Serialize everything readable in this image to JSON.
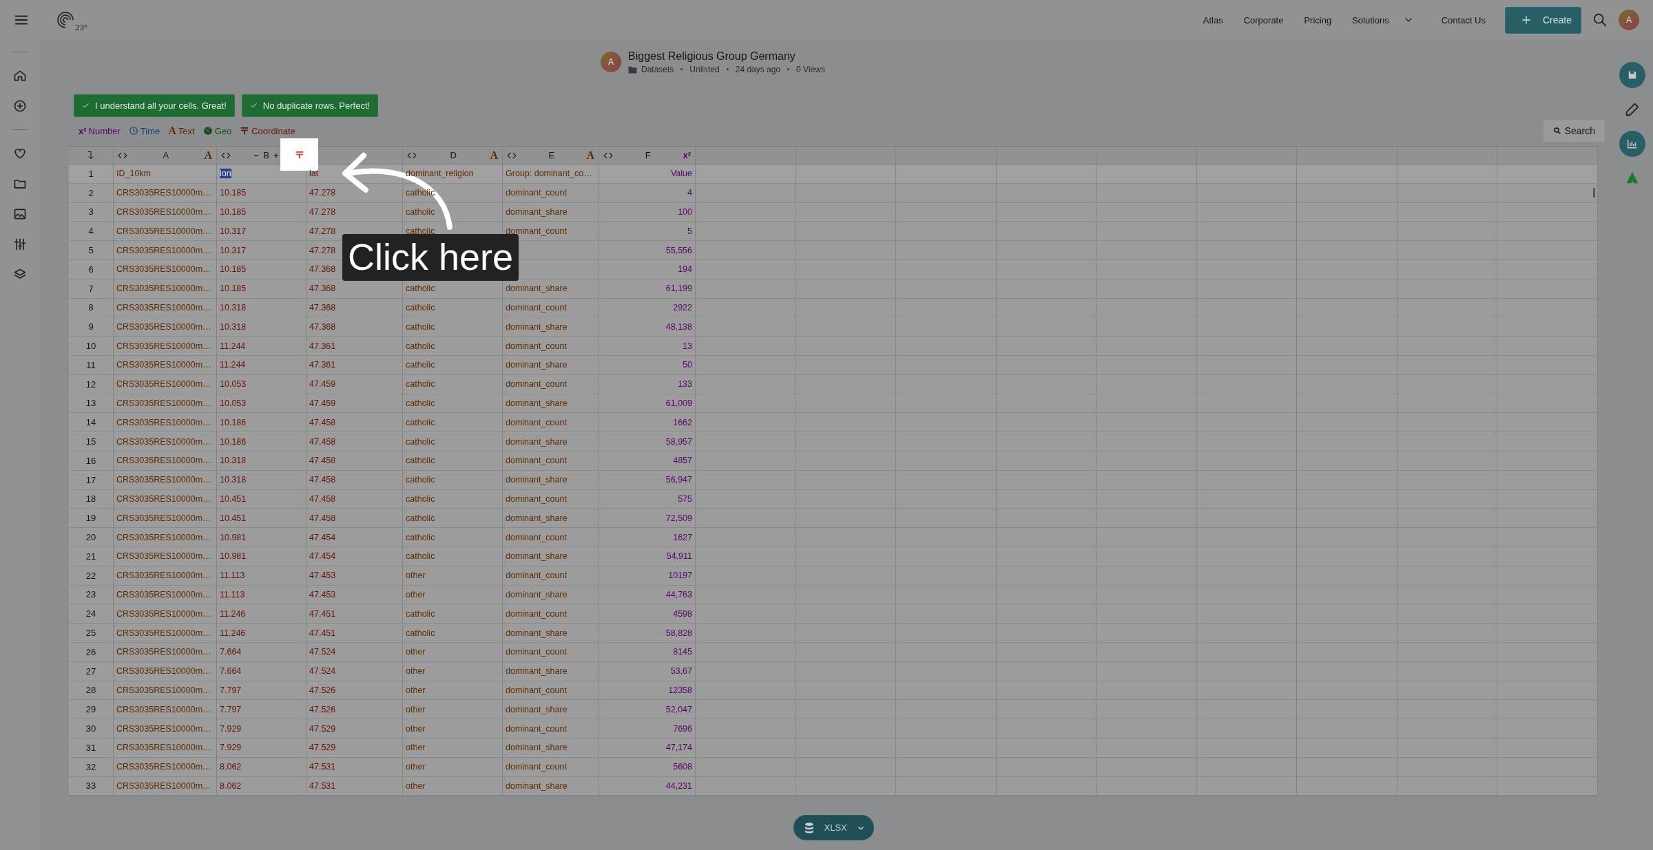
{
  "nav": {
    "logo_text": "23°",
    "links": [
      {
        "label": "Atlas",
        "dropdown": false
      },
      {
        "label": "Corporate",
        "dropdown": false
      },
      {
        "label": "Pricing",
        "dropdown": false
      },
      {
        "label": "Solutions",
        "dropdown": true
      },
      {
        "label": "Contact Us",
        "dropdown": false
      }
    ],
    "create": "Create",
    "avatar": "A"
  },
  "dataset": {
    "avatar": "A",
    "title": "Biggest Religious Group Germany",
    "meta": [
      "Datasets",
      "Unlisted",
      "24 days ago",
      "0 Views"
    ]
  },
  "checks": [
    "I understand all your cells. Great!",
    "No duplicate rows. Perfect!"
  ],
  "legend": [
    {
      "kind": "number",
      "symbol": "x²",
      "label": "Number"
    },
    {
      "kind": "time",
      "label": "Time"
    },
    {
      "kind": "text",
      "symbol": "A",
      "label": "Text"
    },
    {
      "kind": "geo",
      "label": "Geo"
    },
    {
      "kind": "coordinate",
      "label": "Coordinate"
    }
  ],
  "search": "Search",
  "table": {
    "columns": [
      {
        "letter": "A",
        "kind": "text",
        "symbol": "A",
        "stepper": false,
        "spotlight": false
      },
      {
        "letter": "B",
        "kind": "coordinate",
        "stepper": true,
        "spotlight": true
      },
      {
        "kind": "coordinate"
      },
      {
        "letter": "D",
        "kind": "text",
        "symbol": "A",
        "stepper": false,
        "spotlight": false
      },
      {
        "letter": "E",
        "kind": "text",
        "symbol": "A",
        "stepper": false,
        "spotlight": false
      },
      {
        "letter": "F",
        "kind": "number",
        "symbol": "x²",
        "stepper": false,
        "spotlight": false
      }
    ],
    "header_row": {
      "number": "1",
      "cells": [
        {
          "text": "ID_10km",
          "selected": false
        },
        {
          "text": "lon",
          "selected": true
        },
        {
          "text": "lat",
          "selected": false
        },
        {
          "text": "dominant_religion",
          "selected": false
        },
        {
          "text": "Group: dominant_co…",
          "selected": false
        },
        {
          "text": "Value",
          "selected": false
        }
      ]
    },
    "rows": [
      {
        "number": "2",
        "cells": [
          "CRS3035RES10000m…",
          "10.185",
          "47.278",
          "catholic",
          "dominant_count",
          "4"
        ]
      },
      {
        "number": "3",
        "cells": [
          "CRS3035RES10000m…",
          "10.185",
          "47.278",
          "catholic",
          "dominant_share",
          "100"
        ]
      },
      {
        "number": "4",
        "cells": [
          "CRS3035RES10000m…",
          "10.317",
          "47.278",
          "catholic",
          "dominant_count",
          "5"
        ]
      },
      {
        "number": "5",
        "cells": [
          "CRS3035RES10000m…",
          "10.317",
          "47.278",
          null,
          null,
          "55,556"
        ]
      },
      {
        "number": "6",
        "cells": [
          "CRS3035RES10000m…",
          "10.185",
          "47.368",
          null,
          null,
          "194"
        ]
      },
      {
        "number": "7",
        "cells": [
          "CRS3035RES10000m…",
          "10.185",
          "47.368",
          "catholic",
          "dominant_share",
          "61,199"
        ]
      },
      {
        "number": "8",
        "cells": [
          "CRS3035RES10000m…",
          "10.318",
          "47.368",
          "catholic",
          "dominant_count",
          "2922"
        ]
      },
      {
        "number": "9",
        "cells": [
          "CRS3035RES10000m…",
          "10.318",
          "47.368",
          "catholic",
          "dominant_share",
          "48,138"
        ]
      },
      {
        "number": "10",
        "cells": [
          "CRS3035RES10000m…",
          "11.244",
          "47.361",
          "catholic",
          "dominant_count",
          "13"
        ]
      },
      {
        "number": "11",
        "cells": [
          "CRS3035RES10000m…",
          "11.244",
          "47.361",
          "catholic",
          "dominant_share",
          "50"
        ]
      },
      {
        "number": "12",
        "cells": [
          "CRS3035RES10000m…",
          "10.053",
          "47.459",
          "catholic",
          "dominant_count",
          "133"
        ]
      },
      {
        "number": "13",
        "cells": [
          "CRS3035RES10000m…",
          "10.053",
          "47.459",
          "catholic",
          "dominant_share",
          "61,009"
        ]
      },
      {
        "number": "14",
        "cells": [
          "CRS3035RES10000m…",
          "10.186",
          "47.458",
          "catholic",
          "dominant_count",
          "1662"
        ]
      },
      {
        "number": "15",
        "cells": [
          "CRS3035RES10000m…",
          "10.186",
          "47.458",
          "catholic",
          "dominant_share",
          "58,957"
        ]
      },
      {
        "number": "16",
        "cells": [
          "CRS3035RES10000m…",
          "10.318",
          "47.458",
          "catholic",
          "dominant_count",
          "4857"
        ]
      },
      {
        "number": "17",
        "cells": [
          "CRS3035RES10000m…",
          "10.318",
          "47.458",
          "catholic",
          "dominant_share",
          "56,947"
        ]
      },
      {
        "number": "18",
        "cells": [
          "CRS3035RES10000m…",
          "10.451",
          "47.458",
          "catholic",
          "dominant_count",
          "575"
        ]
      },
      {
        "number": "19",
        "cells": [
          "CRS3035RES10000m…",
          "10.451",
          "47.458",
          "catholic",
          "dominant_share",
          "72,509"
        ]
      },
      {
        "number": "20",
        "cells": [
          "CRS3035RES10000m…",
          "10.981",
          "47.454",
          "catholic",
          "dominant_count",
          "1627"
        ]
      },
      {
        "number": "21",
        "cells": [
          "CRS3035RES10000m…",
          "10.981",
          "47.454",
          "catholic",
          "dominant_share",
          "54,911"
        ]
      },
      {
        "number": "22",
        "cells": [
          "CRS3035RES10000m…",
          "11.113",
          "47.453",
          "other",
          "dominant_count",
          "10197"
        ]
      },
      {
        "number": "23",
        "cells": [
          "CRS3035RES10000m…",
          "11.113",
          "47.453",
          "other",
          "dominant_share",
          "44,763"
        ]
      },
      {
        "number": "24",
        "cells": [
          "CRS3035RES10000m…",
          "11.246",
          "47.451",
          "catholic",
          "dominant_count",
          "4598"
        ]
      },
      {
        "number": "25",
        "cells": [
          "CRS3035RES10000m…",
          "11.246",
          "47.451",
          "catholic",
          "dominant_share",
          "58,828"
        ]
      },
      {
        "number": "26",
        "cells": [
          "CRS3035RES10000m…",
          "7.664",
          "47.524",
          "other",
          "dominant_count",
          "8145"
        ]
      },
      {
        "number": "27",
        "cells": [
          "CRS3035RES10000m…",
          "7.664",
          "47.524",
          "other",
          "dominant_share",
          "53,67"
        ]
      },
      {
        "number": "28",
        "cells": [
          "CRS3035RES10000m…",
          "7.797",
          "47.526",
          "other",
          "dominant_count",
          "12358"
        ]
      },
      {
        "number": "29",
        "cells": [
          "CRS3035RES10000m…",
          "7.797",
          "47.526",
          "other",
          "dominant_share",
          "52,047"
        ]
      },
      {
        "number": "30",
        "cells": [
          "CRS3035RES10000m…",
          "7.929",
          "47.529",
          "other",
          "dominant_count",
          "7696"
        ]
      },
      {
        "number": "31",
        "cells": [
          "CRS3035RES10000m…",
          "7.929",
          "47.529",
          "other",
          "dominant_share",
          "47,174"
        ]
      },
      {
        "number": "32",
        "cells": [
          "CRS3035RES10000m…",
          "8.062",
          "47.531",
          "other",
          "dominant_count",
          "5608"
        ]
      },
      {
        "number": "33",
        "cells": [
          "CRS3035RES10000m…",
          "8.062",
          "47.531",
          "other",
          "dominant_share",
          "44,231"
        ]
      }
    ]
  },
  "export": {
    "format": "XLSX"
  },
  "tutorial": {
    "label": "Click here"
  }
}
